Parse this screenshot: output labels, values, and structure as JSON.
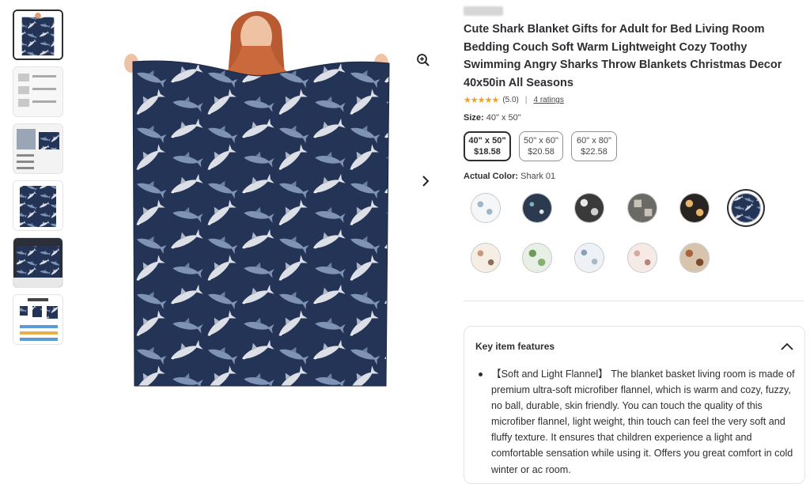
{
  "product": {
    "title": "Cute Shark Blanket Gifts for Adult for Bed Living Room Bedding Couch Soft Warm Lightweight Cozy Toothy Swimming Angry Sharks Throw Blankets Christmas Decor 40x50in All Seasons",
    "rating_stars": "★★★★★",
    "rating_value": "(5.0)",
    "rating_separator": "|",
    "ratings_count": "4 ratings"
  },
  "size": {
    "label": "Size:",
    "selected": "40\" x 50\"",
    "options": [
      {
        "name": "40\" x 50\"",
        "price": "$18.58"
      },
      {
        "name": "50\" x 60\"",
        "price": "$20.58"
      },
      {
        "name": "60\" x 80\"",
        "price": "$22.58"
      }
    ]
  },
  "color": {
    "label": "Actual Color:",
    "selected": "Shark 01"
  },
  "features": {
    "heading": "Key item features",
    "text": "【Soft and Light Flannel】 The blanket basket living room is made of premium ultra-soft microfiber flannel, which is warm and cozy, fuzzy, no ball, durable, skin friendly. You can touch the quality of this microfiber flannel, light weight, thin touch can feel the very soft and fluffy texture. It ensures that children experience a light and comfortable sensation while using it. Offers you great comfort in cold winter or ac room."
  },
  "icons": {
    "zoom": "zoom-in-icon",
    "next": "chevron-right-icon",
    "collapse": "chevron-up-icon"
  },
  "colors": {
    "blanket": "#243456",
    "text": "#2e2f32",
    "star": "#f0a21c"
  }
}
